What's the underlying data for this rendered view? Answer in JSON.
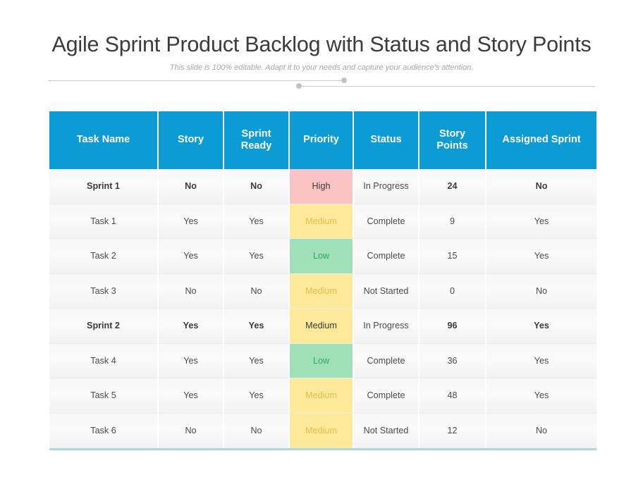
{
  "slide": {
    "title": "Agile Sprint Product Backlog with Status and Story Points",
    "subtitle": "This slide is 100% editable. Adapt it to your needs and capture your audience's attention."
  },
  "theme": {
    "header_blue": "#0b9bd5",
    "bottom_rule": "#aad8e8",
    "priority_high_bg": "#fbc4c4",
    "priority_high_text": "#e8384f",
    "priority_medium_bg": "#fce99a",
    "priority_medium_text": "#e5be47",
    "priority_low_bg": "#9fe0b8",
    "priority_low_text": "#29a862"
  },
  "table": {
    "columns": [
      {
        "key": "task_name",
        "label": "Task Name"
      },
      {
        "key": "story",
        "label": "Story"
      },
      {
        "key": "sprint_ready",
        "label": "Sprint\nReady"
      },
      {
        "key": "priority",
        "label": "Priority"
      },
      {
        "key": "status",
        "label": "Status"
      },
      {
        "key": "story_points",
        "label": "Story\nPoints"
      },
      {
        "key": "assigned_sprint",
        "label": "Assigned Sprint"
      }
    ],
    "rows": [
      {
        "task_name": "Sprint 1",
        "story": "No",
        "sprint_ready": "No",
        "priority": "High",
        "priority_level": "high",
        "status": "In Progress",
        "story_points": "24",
        "assigned_sprint": "No",
        "is_sprint": true
      },
      {
        "task_name": "Task 1",
        "story": "Yes",
        "sprint_ready": "Yes",
        "priority": "Medium",
        "priority_level": "medium",
        "status": "Complete",
        "story_points": "9",
        "assigned_sprint": "Yes",
        "is_sprint": false
      },
      {
        "task_name": "Task 2",
        "story": "Yes",
        "sprint_ready": "Yes",
        "priority": "Low",
        "priority_level": "low",
        "status": "Complete",
        "story_points": "15",
        "assigned_sprint": "Yes",
        "is_sprint": false
      },
      {
        "task_name": "Task 3",
        "story": "No",
        "sprint_ready": "No",
        "priority": "Medium",
        "priority_level": "medium",
        "status": "Not Started",
        "story_points": "0",
        "assigned_sprint": "No",
        "is_sprint": false
      },
      {
        "task_name": "Sprint 2",
        "story": "Yes",
        "sprint_ready": "Yes",
        "priority": "Medium",
        "priority_level": "medium",
        "status": "In Progress",
        "story_points": "96",
        "assigned_sprint": "Yes",
        "is_sprint": true
      },
      {
        "task_name": "Task 4",
        "story": "Yes",
        "sprint_ready": "Yes",
        "priority": "Low",
        "priority_level": "low",
        "status": "Complete",
        "story_points": "36",
        "assigned_sprint": "Yes",
        "is_sprint": false
      },
      {
        "task_name": "Task 5",
        "story": "Yes",
        "sprint_ready": "Yes",
        "priority": "Medium",
        "priority_level": "medium",
        "status": "Complete",
        "story_points": "48",
        "assigned_sprint": "Yes",
        "is_sprint": false
      },
      {
        "task_name": "Task 6",
        "story": "No",
        "sprint_ready": "No",
        "priority": "Medium",
        "priority_level": "medium",
        "status": "Not Started",
        "story_points": "12",
        "assigned_sprint": "No",
        "is_sprint": false
      }
    ]
  }
}
